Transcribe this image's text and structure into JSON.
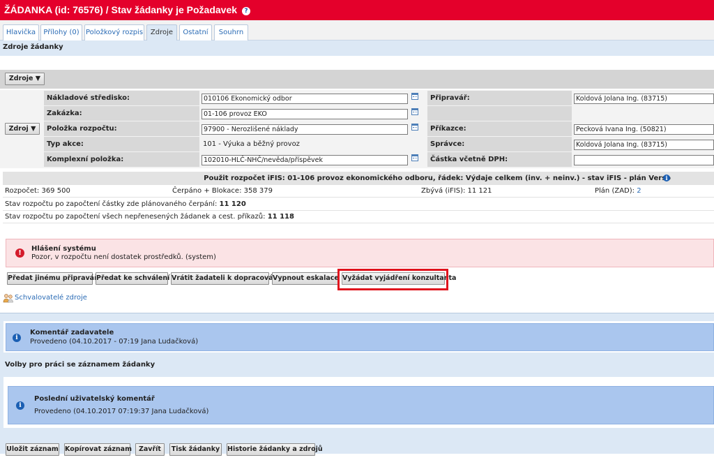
{
  "header": {
    "title": "ŽÁDANKA (id: 76576) / Stav žádanky je Požadavek",
    "help_icon": "?"
  },
  "tabs": [
    {
      "label": "Hlavička"
    },
    {
      "label": "Přílohy (0)"
    },
    {
      "label": "Položkový rozpis"
    },
    {
      "label": "Zdroje"
    },
    {
      "label": "Ostatní"
    },
    {
      "label": "Souhrn"
    }
  ],
  "active_tab": "Zdroje",
  "section_title": "Zdroje žádanky",
  "zdroje_dropdown": "Zdroje ▼",
  "zdroj_dropdown": "Zdroj ▼",
  "form": {
    "left": [
      {
        "label": "Nákladové středisko:",
        "value": "010106 Ekonomický odbor"
      },
      {
        "label": "Zakázka:",
        "value": "01-106 provoz EKO"
      },
      {
        "label": "Položka rozpočtu:",
        "value": "97900 - Nerozlišené náklady"
      },
      {
        "label": "Typ akce:",
        "value": "101 - Výuka a běžný provoz"
      },
      {
        "label": "Komplexní položka:",
        "value": "102010-HLČ-NHČ/nevěda/příspěvek"
      }
    ],
    "right": [
      {
        "label": "Připravář:",
        "value": "Koldová Jolana Ing.  (83715)"
      },
      {
        "label": "",
        "value": ""
      },
      {
        "label": "Příkazce:",
        "value": "Pecková Ivana Ing.  (50821)"
      },
      {
        "label": "Správce:",
        "value": "Koldová Jolana Ing.  (83715)"
      },
      {
        "label": "Částka včetně DPH:",
        "value": ""
      }
    ]
  },
  "budget": {
    "header": "Použit rozpočet iFIS: 01-106 provoz ekonomického odboru, řádek: Výdaje celkem (inv. + neinv.) - stav iFIS - plán Verso",
    "rozpocet": "Rozpočet: 369 500",
    "cerpano": "Čerpáno + Blokace: 358 379",
    "zbyva": "Zbývá (iFIS): 11 121",
    "plan_label": "Plán (ZAD):",
    "plan_value": "2",
    "stav1_label": "Stav rozpočtu po započtení částky zde plánovaného čerpání:",
    "stav1_value": "11 120",
    "stav2_label": "Stav rozpočtu po započtení všech nepřenesených žádanek a cest. příkazů:",
    "stav2_value": "11 118"
  },
  "alert": {
    "title": "Hlášení systému",
    "message": "Pozor, v rozpočtu není dostatek prostředků. (system)",
    "icon": "!"
  },
  "actions": [
    {
      "label": "Předat jinému připraváři"
    },
    {
      "label": "Předat ke schválení"
    },
    {
      "label": "Vrátit žadateli k dopracování"
    },
    {
      "label": "Vypnout eskalace"
    },
    {
      "label": "Vyžádat vyjádření konzultanta"
    }
  ],
  "approvers_link": "Schvalovatelé zdroje",
  "comment": {
    "title": "Komentář zadavatele",
    "text": "Provedeno (04.10.2017 - 07:19 Jana Ludačková)"
  },
  "options_title": "Volby pro práci se záznamem žádanky",
  "last_comment": {
    "title": "Poslední uživatelský komentář",
    "text": "Provedeno (04.10.2017 07:19:37 Jana Ludačková)"
  },
  "info_icon": "i",
  "bottom_buttons": [
    {
      "label": "Uložit záznam"
    },
    {
      "label": "Kopírovat záznam"
    },
    {
      "label": "Zavřít"
    },
    {
      "label": "Tisk žádanky"
    },
    {
      "label": "Historie žádanky a zdrojů"
    }
  ],
  "colors": {
    "brand_red": "#e4002b",
    "info_blue": "#aac6ee",
    "section_blue": "#dce8f5",
    "alert_pink": "#fbe3e5"
  }
}
